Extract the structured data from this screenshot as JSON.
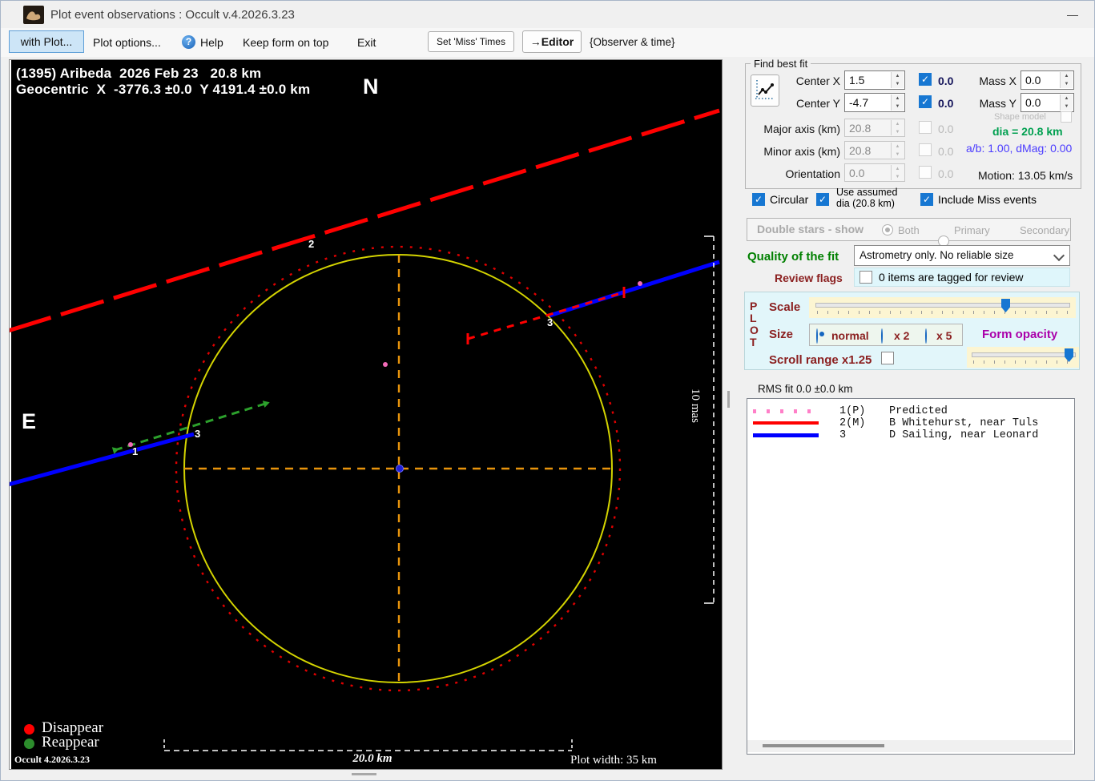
{
  "window": {
    "title": "Plot event observations : Occult v.4.2026.3.23"
  },
  "icons": {
    "help": "?",
    "check": "✓",
    "minimize": "—",
    "spin_up": "▲",
    "spin_down": "▼"
  },
  "toolbar": {
    "with_plot": "with Plot...",
    "plot_options": "Plot options...",
    "help": "Help",
    "keep_on_top": "Keep form on top",
    "exit": "Exit",
    "set_miss_times": "Set 'Miss' Times",
    "editor": "→Editor",
    "observer_time": "{Observer & time}"
  },
  "plot": {
    "title_line1": "(1395) Aribeda  2026 Feb 23   20.8 km",
    "title_line2": "Geocentric  X  -3776.3 ±0.0  Y 4191.4 ±0.0 km",
    "north": "N",
    "east": "E",
    "label_1": "1",
    "label_2": "2",
    "label_3": "3",
    "legend_disappear": "Disappear",
    "legend_reappear": "Reappear",
    "version": "Occult 4.2026.3.23",
    "scalebar_label": "20.0 km",
    "plot_width": "Plot width: 35 km",
    "mas_label": "10 mas",
    "colors": {
      "predicted_dot": "#f26bb8",
      "disappear": "#ff0000",
      "reappear": "#2ca02c",
      "asteroid_circle": "#d4d400",
      "uncertainty_circle": "#e00000",
      "crosshair": "#e8940c",
      "chord_blue": "#0000ff"
    }
  },
  "find_best_fit": {
    "group_label": "Find best fit",
    "center_x": {
      "label": "Center X",
      "value": "1.5",
      "err": "0.0"
    },
    "center_y": {
      "label": "Center Y",
      "value": "-4.7",
      "err": "0.0"
    },
    "mass_x": {
      "label": "Mass X",
      "value": "0.0"
    },
    "mass_y": {
      "label": "Mass Y",
      "value": "0.0"
    },
    "shape_model": "Shape model",
    "major_axis": {
      "label": "Major axis (km)",
      "value": "20.8",
      "err": "0.0"
    },
    "minor_axis": {
      "label": "Minor axis (km)",
      "value": "20.8",
      "err": "0.0"
    },
    "orientation": {
      "label": "Orientation",
      "value": "0.0",
      "err": "0.0"
    },
    "dia": "dia = 20.8 km",
    "ab_dmag": "a/b: 1.00, dMag: 0.00",
    "motion": "Motion: 13.05 km/s",
    "circular": "Circular",
    "use_assumed_line1": "Use assumed",
    "use_assumed_line2": "dia (20.8 km)",
    "include_miss": "Include Miss events"
  },
  "double_stars": {
    "label": "Double stars - show",
    "both": "Both",
    "primary": "Primary",
    "secondary": "Secondary"
  },
  "quality": {
    "label": "Quality of the fit",
    "value": "Astrometry only. No reliable size"
  },
  "review": {
    "label": "Review flags",
    "value": "0 items are tagged for review"
  },
  "plot_controls": {
    "p": "P",
    "l": "L",
    "o": "O",
    "t": "T",
    "scale": "Scale",
    "size": "Size",
    "size_normal": "normal",
    "size_x2": "x 2",
    "size_x5": "x 5",
    "form_opacity": "Form opacity",
    "scroll_range": "Scroll range x1.25"
  },
  "rms": "RMS fit 0.0 ±0.0 km",
  "legend": {
    "rows": [
      {
        "num": "1(P)",
        "name": "Predicted",
        "color": "#ff7fc8",
        "style": "dotted"
      },
      {
        "num": "2(M)",
        "name": "B Whitehurst, near Tuls",
        "color": "#ff0000",
        "style": "solid"
      },
      {
        "num": "3",
        "name": "D Sailing, near Leonard",
        "color": "#0000ff",
        "style": "solid"
      }
    ]
  }
}
